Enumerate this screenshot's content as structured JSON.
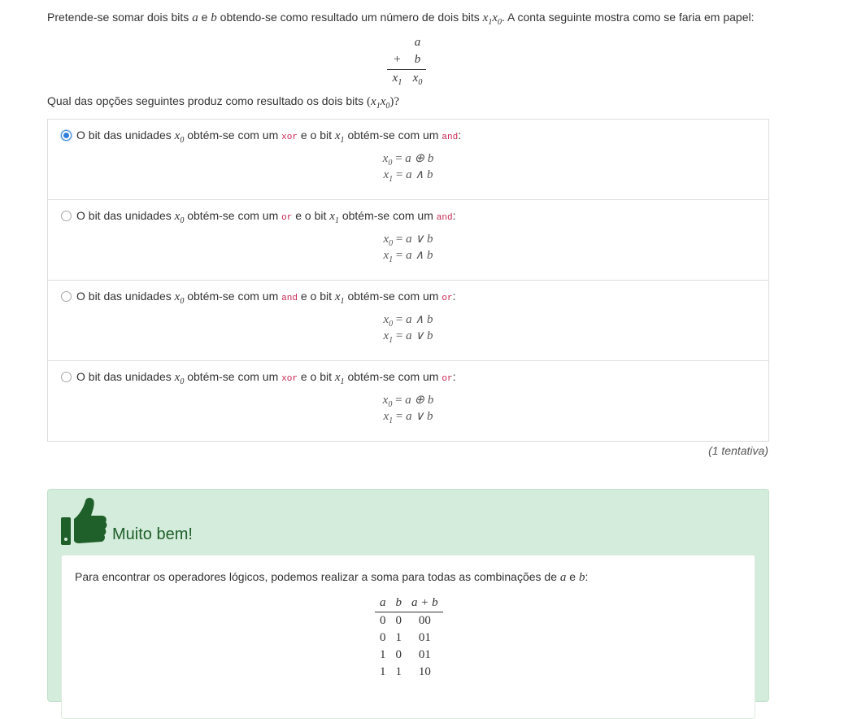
{
  "intro": {
    "text_before": "Pretende-se somar dois bits",
    "var_a": "a",
    "conj": "e",
    "var_b": "b",
    "text_after": "obtendo-se como resultado um número de dois bits",
    "var_x1": "x",
    "sub_1": "1",
    "var_x0": "x",
    "sub_0": "0",
    "text_end": ". A conta seguinte mostra como se faria em papel:"
  },
  "sum": {
    "row1": "a",
    "plus": "+",
    "row2": "b",
    "res_x1": "x",
    "res_x1_sub": "1",
    "res_x0": "x",
    "res_x0_sub": "0"
  },
  "question": {
    "text": "Qual das opções seguintes produz como resultado os dois bits",
    "paren_open": "(",
    "x1": "x",
    "x1_sub": "1",
    "x0": "x",
    "x0_sub": "0",
    "paren_close": ")?"
  },
  "option_common": {
    "part1": "O bit das unidades",
    "part2": "obtém-se com um",
    "part3": "e o bit",
    "part4": "obtém-se com um",
    "x": "x",
    "sub0": "0",
    "sub1": "1",
    "colon": ":",
    "eq": "="
  },
  "options": [
    {
      "selected": true,
      "op0": "xor",
      "op1": "and",
      "eq0": "a ⊕ b",
      "eq1": "a ∧ b"
    },
    {
      "selected": false,
      "op0": "or",
      "op1": "and",
      "eq0": "a ∨ b",
      "eq1": "a ∧ b"
    },
    {
      "selected": false,
      "op0": "and",
      "op1": "or",
      "eq0": "a ∧ b",
      "eq1": "a ∨ b"
    },
    {
      "selected": false,
      "op0": "xor",
      "op1": "or",
      "eq0": "a ⊕ b",
      "eq1": "a ∨ b"
    }
  ],
  "attempts": "(1 tentativa)",
  "feedback": {
    "title": "Muito bem!",
    "icon": "thumbs-up-icon",
    "color": "#1f5f2a",
    "text_before": "Para encontrar os operadores lógicos, podemos realizar a soma para todas as combinações de",
    "var_a": "a",
    "conj": "e",
    "var_b": "b",
    "colon": ":",
    "table": {
      "headers": [
        "a",
        "b",
        "a + b"
      ],
      "rows": [
        [
          "0",
          "0",
          "00"
        ],
        [
          "0",
          "1",
          "01"
        ],
        [
          "1",
          "0",
          "01"
        ],
        [
          "1",
          "1",
          "10"
        ]
      ]
    }
  }
}
